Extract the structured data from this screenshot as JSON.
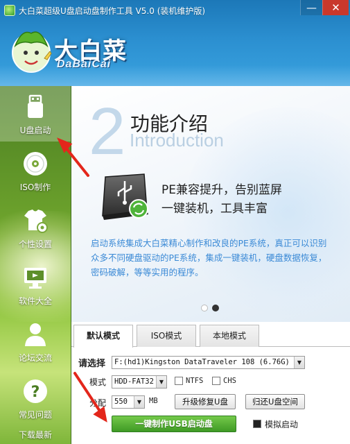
{
  "window": {
    "title": "大白菜超级U盘启动盘制作工具 V5.0 (装机维护版)",
    "min_symbol": "—",
    "close_symbol": "✕"
  },
  "logo": {
    "cn": "大白菜",
    "en": "DaBaiCai"
  },
  "sidebar": {
    "items": [
      {
        "label": "U盘启动",
        "icon": "usb-drive-icon",
        "active": true
      },
      {
        "label": "ISO制作",
        "icon": "disc-icon",
        "active": false
      },
      {
        "label": "个性设置",
        "icon": "tshirt-gear-icon",
        "active": false
      },
      {
        "label": "软件大全",
        "icon": "monitor-icon",
        "active": false
      },
      {
        "label": "论坛交流",
        "icon": "user-icon",
        "active": false
      },
      {
        "label": "常见问题",
        "icon": "question-icon",
        "active": false
      }
    ],
    "footer_label": "下载最新"
  },
  "banner": {
    "number": "2",
    "title_cn": "功能介绍",
    "title_en": "Introduction",
    "headline_line1": "PE兼容提升，告别蓝屏",
    "headline_line2": "一键装机，工具丰富",
    "description": "启动系统集成大白菜精心制作和改良的PE系统，真正可以识别众多不同硬盘驱动的PE系统，集成一键装机，硬盘数据恢复，密码破解，等等实用的程序。",
    "pager_current": 2,
    "pager_total": 2
  },
  "tabs": [
    {
      "label": "默认模式",
      "active": true
    },
    {
      "label": "ISO模式",
      "active": false
    },
    {
      "label": "本地模式",
      "active": false
    }
  ],
  "form": {
    "select_label": "请选择",
    "device_value": "F:(hd1)Kingston DataTraveler 108 (6.76G)",
    "mode_label": "模式",
    "mode_value": "HDD-FAT32",
    "ntfs_label": "NTFS",
    "chs_label": "CHS",
    "alloc_label": "分配",
    "alloc_value": "550",
    "alloc_unit": "MB",
    "upgrade_button": "升级修复U盘",
    "restore_button": "归还U盘空间",
    "make_button": "一键制作USB启动盘",
    "simulate_label": "模拟启动"
  },
  "colors": {
    "accent_blue": "#2b8fd0",
    "sidebar_green": "#6fa52d",
    "desc_blue": "#3b8ad6",
    "primary_green": "#3f9a25",
    "annotation_red": "#e3261b"
  }
}
